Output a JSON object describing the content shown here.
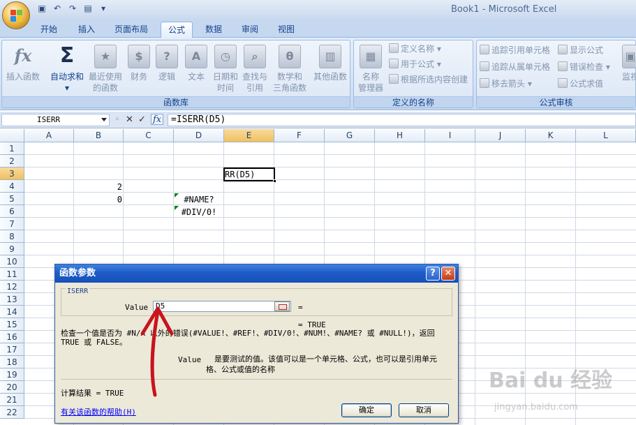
{
  "window": {
    "title": "Book1 - Microsoft Excel"
  },
  "tabs": [
    "开始",
    "插入",
    "页面布局",
    "公式",
    "数据",
    "审阅",
    "视图"
  ],
  "active_tab": "公式",
  "ribbon": {
    "function_library": {
      "label": "函数库",
      "insert_function": "插入函数",
      "autosum_1": "自动求和",
      "recent_1": "最近使用",
      "recent_2": "的函数",
      "financial": "财务",
      "logical": "逻辑",
      "text": "文本",
      "datetime_1": "日期和",
      "datetime_2": "时间",
      "lookup_1": "查找与",
      "lookup_2": "引用",
      "math_1": "数学和",
      "math_2": "三角函数",
      "more": "其他函数"
    },
    "defined_names": {
      "label": "定义的名称",
      "name_manager_1": "名称",
      "name_manager_2": "管理器",
      "define_name": "定义名称",
      "use_in_formula": "用于公式",
      "create_from_selection": "根据所选内容创建"
    },
    "formula_auditing": {
      "label": "公式审核",
      "trace_precedents": "追踪引用单元格",
      "trace_dependents": "追踪从属单元格",
      "remove_arrows": "移去箭头",
      "show_formulas": "显示公式",
      "error_checking": "错误检查",
      "evaluate_formula": "公式求值",
      "watch_window": "监视"
    }
  },
  "formula_bar": {
    "name_box": "ISERR",
    "formula": "=ISERR(D5)",
    "fx": "fx"
  },
  "sheet": {
    "columns": [
      "A",
      "B",
      "C",
      "D",
      "E",
      "F",
      "G",
      "H",
      "I",
      "J",
      "K",
      "L"
    ],
    "rows": [
      "1",
      "2",
      "3",
      "4",
      "5",
      "6",
      "7",
      "8",
      "9",
      "10",
      "11",
      "12",
      "13",
      "14",
      "15",
      "16",
      "17",
      "18",
      "19",
      "20",
      "21",
      "22"
    ],
    "cells": {
      "E3": "RR(D5)",
      "B4": "2",
      "B5": "0",
      "D5": "#NAME?",
      "D6": "#DIV/0!"
    }
  },
  "dialog": {
    "title": "函数参数",
    "group_title": "ISERR",
    "value_label": "Value",
    "value_input": "D5",
    "equals": "=",
    "result_preview": "=  TRUE",
    "description": "检查一个值是否为 #N/A 以外的错误(#VALUE!、#REF!、#DIV/0!、#NUM!、#NAME? 或 #NULL!)，返回 TRUE 或 FALSE。",
    "param_name": "Value",
    "param_desc_1": "是要测试的值。该值可以是一个单元格、公式，也可以是引用单元",
    "param_desc_2": "格、公式或值的名称",
    "calc_result": "计算结果 =  TRUE",
    "help_link": "有关该函数的帮助(H)",
    "ok": "确定",
    "cancel": "取消"
  },
  "watermark": {
    "main": "Bai du 经验",
    "sub": "jingyan.baidu.com"
  },
  "colors": {
    "ribbon_bg": "#dbe6f5",
    "title_blue": "#1e5cc8",
    "annotation_red": "#c8141e"
  }
}
